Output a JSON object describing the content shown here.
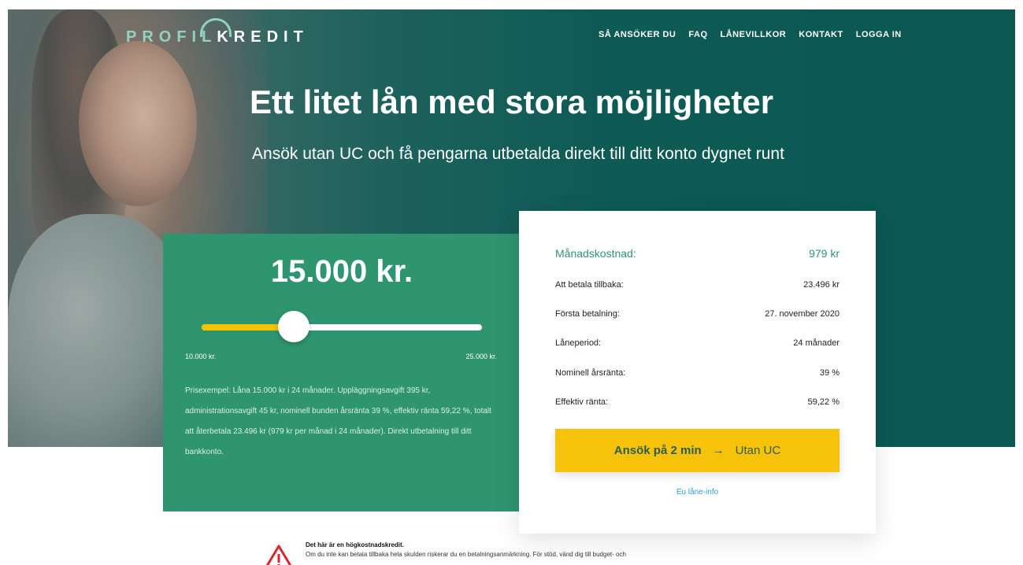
{
  "header": {
    "logo": {
      "part1": "PROFIL",
      "part2": "KREDIT"
    },
    "nav": [
      "SÅ ANSÖKER DU",
      "FAQ",
      "LÅNEVILLKOR",
      "KONTAKT",
      "LOGGA IN"
    ]
  },
  "hero": {
    "headline": "Ett litet lån med stora möjligheter",
    "subheadline": "Ansök utan UC och få pengarna utbetalda direkt till ditt konto dygnet runt"
  },
  "calculator": {
    "amount": "15.000 kr.",
    "slider": {
      "min_label": "10.000 kr.",
      "max_label": "25.000 kr.",
      "value_fraction": 0.33
    },
    "price_example": "Prisexempel: Låna 15.000 kr i 24 månader. Uppläggningsavgift 395 kr, administrationsavgift 45 kr, nominell bunden årsränta 39 %, effektiv ränta 59,22 %, totalt att återbetala 23.496 kr (979 kr per månad i 24 månader). Direkt utbetalning till ditt bankkonto."
  },
  "summary": {
    "monthly_label": "Månadskostnad:",
    "monthly_value": "979 kr",
    "rows": [
      {
        "label": "Att betala tillbaka:",
        "value": "23.496 kr"
      },
      {
        "label": "Första betalning:",
        "value": "27. november 2020"
      },
      {
        "label": "Låneperiod:",
        "value": "24 månader"
      },
      {
        "label": "Nominell årsränta:",
        "value": "39 %"
      },
      {
        "label": "Effektiv ränta:",
        "value": "59,22 %"
      }
    ],
    "apply_main": "Ansök på 2 min",
    "apply_arrow": "→",
    "apply_sub": "Utan UC",
    "eu_link": "Eu låne-info"
  },
  "warning": {
    "title": "Det här är en högkostnadskredit.",
    "text": "Om du inte kan betala tillbaka hela skulden riskerar du en betalningsanmärkning. För stöd, vänd dig till budget- och"
  },
  "colors": {
    "hero_teal": "#0b5752",
    "panel_green": "#2f9470",
    "accent_yellow": "#f7c20a",
    "link_blue": "#2f9ed8",
    "warning_red": "#d9252b"
  }
}
